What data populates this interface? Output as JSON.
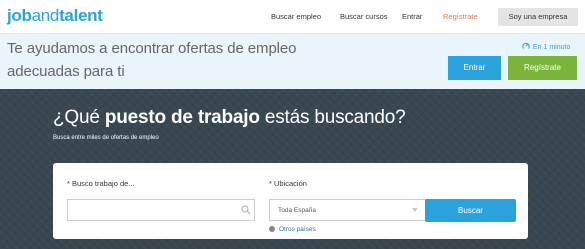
{
  "header": {
    "logo": {
      "part1": "job",
      "part2": "and",
      "part3": "talent"
    },
    "nav": {
      "job_search": "Buscar empleo",
      "course_search": "Buscar cursos",
      "login": "Entrar",
      "register": "Regístrate",
      "company": "Soy una empresa"
    }
  },
  "banner": {
    "line1": "Te ayudamos a encontrar ofertas de empleo",
    "line2": "adecuadas para ti",
    "quick_text": "En 1 minuto",
    "enter_label": "Entrar",
    "register_label": "Regístrate"
  },
  "hero": {
    "title_pre": "¿Qué ",
    "title_bold": "puesto de trabajo",
    "title_post": " estás buscando?",
    "subtitle": "Busca entre miles de ofertas de empleo"
  },
  "search": {
    "job_label": "* Busco trabajo de...",
    "job_value": "",
    "location_label": "* Ubicación",
    "location_value": "Toda España",
    "button_label": "Buscar",
    "other_countries": "Otros países"
  },
  "colors": {
    "brand_blue": "#2aa2dc",
    "register_green": "#7ab43a",
    "register_orange": "#e8734a",
    "hero_bg": "#394751",
    "banner_bg": "#e9f4fb"
  },
  "icons": {
    "quick": "timer-icon",
    "search": "magnifier-icon",
    "location_caret": "caret-down-icon",
    "other_countries": "globe-icon"
  }
}
